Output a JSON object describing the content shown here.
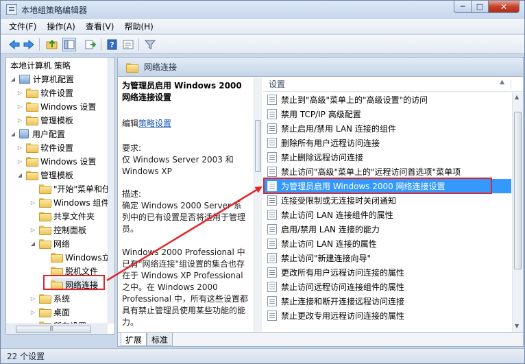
{
  "window": {
    "title": "本地组策略编辑器",
    "controls": {
      "minimize": "─",
      "maximize": "□",
      "close": "✕"
    }
  },
  "menubar": [
    "文件(F)",
    "操作(A)",
    "查看(V)",
    "帮助(H)"
  ],
  "toolbar": {
    "icons": [
      "back-icon",
      "forward-icon",
      "up-folder-icon",
      "show-hide-tree-icon",
      "export-list-icon",
      "help-icon",
      "properties-icon",
      "filter-icon"
    ]
  },
  "tree": {
    "items": [
      {
        "label": "本地计算机 策略",
        "expander": ""
      },
      {
        "label": "计算机配置",
        "expander": "◢"
      },
      {
        "label": "软件设置",
        "expander": "▷"
      },
      {
        "label": "Windows 设置",
        "expander": "▷"
      },
      {
        "label": "管理模板",
        "expander": "▷"
      },
      {
        "label": "用户配置",
        "expander": "◢"
      },
      {
        "label": "软件设置",
        "expander": "▷"
      },
      {
        "label": "Windows 设置",
        "expander": "▷"
      },
      {
        "label": "管理模板",
        "expander": "◢"
      },
      {
        "label": "\"开始\"菜单和任",
        "expander": ""
      },
      {
        "label": "Windows 组件",
        "expander": "▷"
      },
      {
        "label": "共享文件夹",
        "expander": ""
      },
      {
        "label": "控制面板",
        "expander": "▷"
      },
      {
        "label": "网络",
        "expander": "◢"
      },
      {
        "label": "Windows立即",
        "expander": ""
      },
      {
        "label": "脱机文件",
        "expander": ""
      },
      {
        "label": "网络连接",
        "expander": ""
      },
      {
        "label": "系统",
        "expander": "▷"
      },
      {
        "label": "桌面",
        "expander": "▷"
      },
      {
        "label": "所有设置",
        "expander": ""
      }
    ]
  },
  "right_header": {
    "title": "网络连接"
  },
  "description": {
    "title": "为管理员启用 Windows 2000 网络连接设置",
    "edit_prefix": "编辑",
    "edit_link": "策略设置",
    "req_label": "要求:",
    "req_text": "仅 Windows Server 2003 和 Windows XP",
    "desc_label": "描述:",
    "desc_text": "确定 Windows 2000 Server 系列中的已有设置是否将适用于管理员。",
    "desc_text2": "Windows 2000 Professional 中已有\"网络连接\"组设置的集合也存在于 Windows XP Professional 之中。在 Windows 2000 Professional 中，所有这些设置都具有禁止管理员使用某些功能的能力。"
  },
  "list": {
    "column_header": "设置",
    "items": [
      "禁止到\"高级\"菜单上的\"高级设置\"的访问",
      "禁用 TCP/IP 高级配置",
      "禁止启用/禁用 LAN 连接的组件",
      "删除所有用户远程访问连接",
      "禁止删除远程访问连接",
      "禁止访问\"高级\"菜单上的\"远程访问首选项\"菜单项",
      "为管理员启用 Windows 2000 网络连接设置",
      "连接受限制或无连接时关闭通知",
      "禁止访问 LAN 连接组件的属性",
      "启用/禁用 LAN 连接的能力",
      "禁止访问 LAN 连接的属性",
      "禁止访问\"新建连接向导\"",
      "更改所有用户远程访问连接的属性",
      "禁止访问远程访问连接组件的属性",
      "禁止连接和断开连接远程访问连接",
      "禁止更改专用远程访问连接的属性"
    ],
    "selected_index": 6
  },
  "tabs": [
    "扩展",
    "标准"
  ],
  "status": {
    "text": "22 个设置"
  },
  "colors": {
    "selection": "#3399ff",
    "annotation": "#e0262b"
  }
}
